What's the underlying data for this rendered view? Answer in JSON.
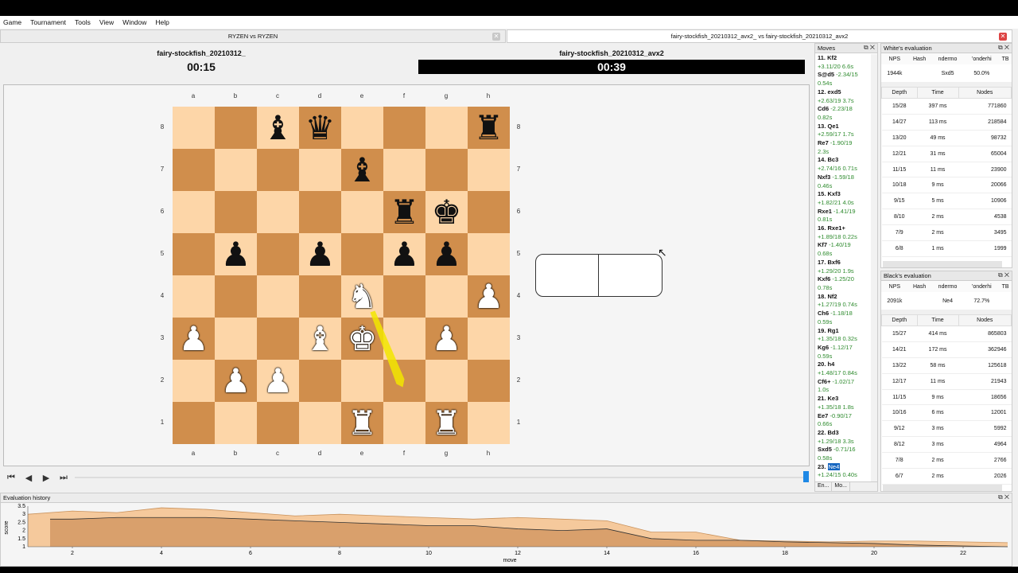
{
  "menu": [
    "Game",
    "Tournament",
    "Tools",
    "View",
    "Window",
    "Help"
  ],
  "tabs": [
    {
      "label": "RYZEN vs RYZEN",
      "active": false
    },
    {
      "label": "fairy-stockfish_20210312_avx2_ vs fairy-stockfish_20210312_avx2",
      "active": true
    }
  ],
  "players": {
    "white": {
      "name": "fairy-stockfish_20210312_",
      "clock": "00:15"
    },
    "black": {
      "name": "fairy-stockfish_20210312_avx2",
      "clock": "00:39"
    }
  },
  "board": {
    "files": [
      "a",
      "b",
      "c",
      "d",
      "e",
      "f",
      "g",
      "h"
    ],
    "ranks": [
      "8",
      "7",
      "6",
      "5",
      "4",
      "3",
      "2",
      "1"
    ],
    "rows": [
      [
        "",
        "",
        "bE",
        "bQ",
        "",
        "",
        "",
        "bR"
      ],
      [
        "",
        "",
        "",
        "",
        "bE",
        "",
        "",
        ""
      ],
      [
        "",
        "",
        "",
        "",
        "",
        "bC",
        "bK",
        ""
      ],
      [
        "",
        "bP",
        "",
        "bP",
        "",
        "bP",
        "bP",
        ""
      ],
      [
        "",
        "",
        "",
        "",
        "wN",
        "",
        "",
        "wP"
      ],
      [
        "wP",
        "",
        "",
        "wB",
        "wK",
        "",
        "wP",
        ""
      ],
      [
        "",
        "wP",
        "wP",
        "",
        "",
        "",
        "",
        ""
      ],
      [
        "",
        "",
        "",
        "",
        "wR",
        "",
        "wR",
        ""
      ]
    ],
    "arrow": {
      "from": "e4",
      "to": "f2",
      "color": "#f2e600"
    }
  },
  "moves_panel": {
    "title": "Moves",
    "lines": [
      {
        "t": "11. Kf2",
        "c": "mv"
      },
      {
        "t": "+3.11/20 6.6s",
        "c": "ev"
      },
      {
        "t": "S@d5",
        "c": "mv",
        "e": " -2.34/15"
      },
      {
        "t": "0.54s",
        "c": "ev"
      },
      {
        "t": "12. exd5",
        "c": "mv"
      },
      {
        "t": "+2.63/19 3.7s",
        "c": "ev"
      },
      {
        "t": "Cd6",
        "c": "mv",
        "e": " -2.23/18"
      },
      {
        "t": "0.82s",
        "c": "ev"
      },
      {
        "t": "13. Qe1",
        "c": "mv"
      },
      {
        "t": "+2.59/17 1.7s",
        "c": "ev"
      },
      {
        "t": "Re7",
        "c": "mv",
        "e": " -1.90/19"
      },
      {
        "t": "2.3s",
        "c": "ev"
      },
      {
        "t": "14. Bc3",
        "c": "mv"
      },
      {
        "t": "+2.74/16 0.71s",
        "c": "ev"
      },
      {
        "t": "Nxf3",
        "c": "mv",
        "e": " -1.59/18"
      },
      {
        "t": "0.46s",
        "c": "ev"
      },
      {
        "t": "15. Kxf3",
        "c": "mv"
      },
      {
        "t": "+1.82/21 4.0s",
        "c": "ev"
      },
      {
        "t": "Rxe1",
        "c": "mv",
        "e": " -1.41/19"
      },
      {
        "t": "0.81s",
        "c": "ev"
      },
      {
        "t": "16. Rxe1+",
        "c": "mv"
      },
      {
        "t": "+1.89/18 0.22s",
        "c": "ev"
      },
      {
        "t": "Kf7",
        "c": "mv",
        "e": " -1.40/19"
      },
      {
        "t": "0.68s",
        "c": "ev"
      },
      {
        "t": "17. Bxf6",
        "c": "mv"
      },
      {
        "t": "+1.29/20 1.9s",
        "c": "ev"
      },
      {
        "t": "Kxf6",
        "c": "mv",
        "e": " -1.25/20"
      },
      {
        "t": "0.78s",
        "c": "ev"
      },
      {
        "t": "18. Nf2",
        "c": "mv"
      },
      {
        "t": "+1.27/19 0.74s",
        "c": "ev"
      },
      {
        "t": "Ch6",
        "c": "mv",
        "e": " -1.18/18"
      },
      {
        "t": "0.59s",
        "c": "ev"
      },
      {
        "t": "19. Rg1",
        "c": "mv"
      },
      {
        "t": "+1.35/18 0.32s",
        "c": "ev"
      },
      {
        "t": "Kg6",
        "c": "mv",
        "e": " -1.12/17"
      },
      {
        "t": "0.59s",
        "c": "ev"
      },
      {
        "t": "20. h4",
        "c": "mv"
      },
      {
        "t": "+1.48/17 0.84s",
        "c": "ev"
      },
      {
        "t": "Cf6+",
        "c": "mv",
        "e": " -1.02/17"
      },
      {
        "t": "1.0s",
        "c": "ev"
      },
      {
        "t": "21. Ke3",
        "c": "mv"
      },
      {
        "t": "+1.35/18 1.8s",
        "c": "ev"
      },
      {
        "t": "Ee7",
        "c": "mv",
        "e": " -0.90/17"
      },
      {
        "t": "0.66s",
        "c": "ev"
      },
      {
        "t": "22. Bd3",
        "c": "mv"
      },
      {
        "t": "+1.29/18 3.3s",
        "c": "ev"
      },
      {
        "t": "Sxd5",
        "c": "mv",
        "e": " -0.71/16"
      },
      {
        "t": "0.58s",
        "c": "ev"
      },
      {
        "t": "23. ",
        "c": "mv",
        "h": "Ne4"
      },
      {
        "t": "+1.24/15 0.40s",
        "c": "ev"
      }
    ],
    "tabs": [
      "En...",
      "Mo..."
    ]
  },
  "white_eval": {
    "title": "White's evaluation",
    "headers": [
      "NPS",
      "Hash",
      "ndermo",
      "'onderhi",
      "TB"
    ],
    "values": [
      "1944k",
      "",
      "Sxd5",
      "50.0%",
      ""
    ],
    "columns": [
      "Depth",
      "Time",
      "Nodes"
    ],
    "rows": [
      [
        "15/28",
        "397 ms",
        "771860"
      ],
      [
        "14/27",
        "113 ms",
        "218584"
      ],
      [
        "13/20",
        "49 ms",
        "98732"
      ],
      [
        "12/21",
        "31 ms",
        "65004"
      ],
      [
        "11/15",
        "11 ms",
        "23900"
      ],
      [
        "10/18",
        "9 ms",
        "20066"
      ],
      [
        "9/15",
        "5 ms",
        "10906"
      ],
      [
        "8/10",
        "2 ms",
        "4538"
      ],
      [
        "7/9",
        "2 ms",
        "3495"
      ],
      [
        "6/8",
        "1 ms",
        "1999"
      ]
    ]
  },
  "black_eval": {
    "title": "Black's evaluation",
    "headers": [
      "NPS",
      "Hash",
      "ndermo",
      "'onderhi",
      "TB"
    ],
    "values": [
      "2091k",
      "",
      "Ne4",
      "72.7%",
      ""
    ],
    "columns": [
      "Depth",
      "Time",
      "Nodes"
    ],
    "rows": [
      [
        "15/27",
        "414 ms",
        "865803"
      ],
      [
        "14/21",
        "172 ms",
        "362946"
      ],
      [
        "13/22",
        "58 ms",
        "125618"
      ],
      [
        "12/17",
        "11 ms",
        "21943"
      ],
      [
        "11/15",
        "9 ms",
        "18656"
      ],
      [
        "10/16",
        "6 ms",
        "12001"
      ],
      [
        "9/12",
        "3 ms",
        "5992"
      ],
      [
        "8/12",
        "3 ms",
        "4964"
      ],
      [
        "7/8",
        "2 ms",
        "2766"
      ],
      [
        "6/7",
        "2 ms",
        "2026"
      ]
    ]
  },
  "history": {
    "title": "Evaluation history",
    "ylabel": "score",
    "xlabel": "move",
    "yticks": [
      "3.5",
      "3",
      "2.5",
      "2",
      "1.5",
      "1"
    ],
    "xticks": [
      "2",
      "4",
      "6",
      "8",
      "10",
      "12",
      "14",
      "16",
      "18",
      "20",
      "22"
    ]
  },
  "chart_data": {
    "type": "area",
    "xlabel": "move",
    "ylabel": "score",
    "ylim": [
      1,
      3.5
    ],
    "xlim": [
      1,
      23
    ],
    "series": [
      {
        "x": [
          1,
          2,
          3,
          4,
          5,
          6,
          7,
          8,
          9,
          10,
          11,
          12,
          13,
          14,
          15,
          16,
          17,
          18,
          19,
          20,
          21,
          22,
          23
        ],
        "values": [
          3.0,
          3.2,
          3.1,
          3.4,
          3.3,
          3.1,
          2.9,
          3.0,
          2.9,
          2.8,
          2.7,
          2.8,
          2.7,
          2.6,
          1.9,
          1.9,
          1.4,
          1.35,
          1.3,
          1.35,
          1.35,
          1.3,
          1.25
        ]
      },
      {
        "x": [
          1.5,
          2,
          3,
          4,
          5,
          6,
          7,
          8,
          9,
          10,
          11,
          12,
          13,
          14,
          15,
          16,
          17,
          18,
          19,
          20,
          21,
          22,
          23
        ],
        "values": [
          2.7,
          2.7,
          2.8,
          2.8,
          2.8,
          2.7,
          2.6,
          2.5,
          2.4,
          2.3,
          2.3,
          2.1,
          2.0,
          2.1,
          1.5,
          1.4,
          1.4,
          1.3,
          1.25,
          1.2,
          1.1,
          1.05,
          1.0
        ]
      }
    ]
  }
}
